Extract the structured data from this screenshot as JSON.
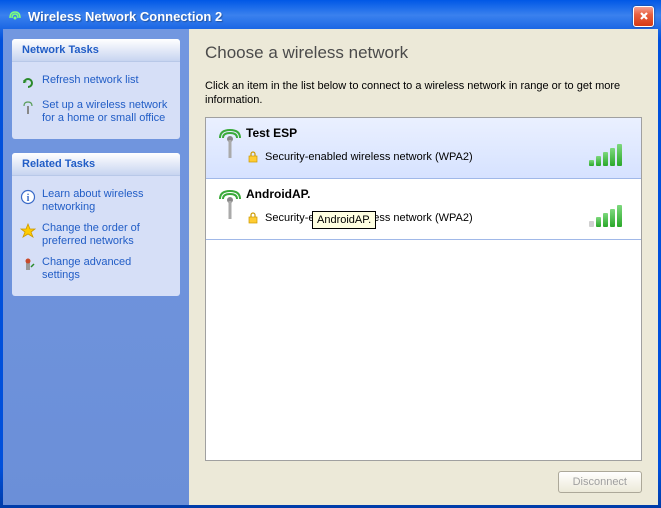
{
  "window": {
    "title": "Wireless Network Connection 2"
  },
  "sidebar": {
    "panels": [
      {
        "title": "Network Tasks",
        "items": [
          {
            "icon": "refresh",
            "label": "Refresh network list"
          },
          {
            "icon": "setup",
            "label": "Set up a wireless network for a home or small office"
          }
        ]
      },
      {
        "title": "Related Tasks",
        "items": [
          {
            "icon": "info",
            "label": "Learn about wireless networking"
          },
          {
            "icon": "star",
            "label": "Change the order of preferred networks"
          },
          {
            "icon": "advanced",
            "label": "Change advanced settings"
          }
        ]
      }
    ]
  },
  "main": {
    "title": "Choose a wireless network",
    "description": "Click an item in the list below to connect to a wireless network in range or to get more information.",
    "networks": [
      {
        "name": "Test ESP",
        "security": "Security-enabled wireless network (WPA2)",
        "signal": 5,
        "selected": true
      },
      {
        "name": "AndroidAP.",
        "security": "Security-enabled wireless network (WPA2)",
        "signal": 4,
        "selected": false
      }
    ],
    "tooltip": "AndroidAP.",
    "disconnect_label": "Disconnect"
  }
}
